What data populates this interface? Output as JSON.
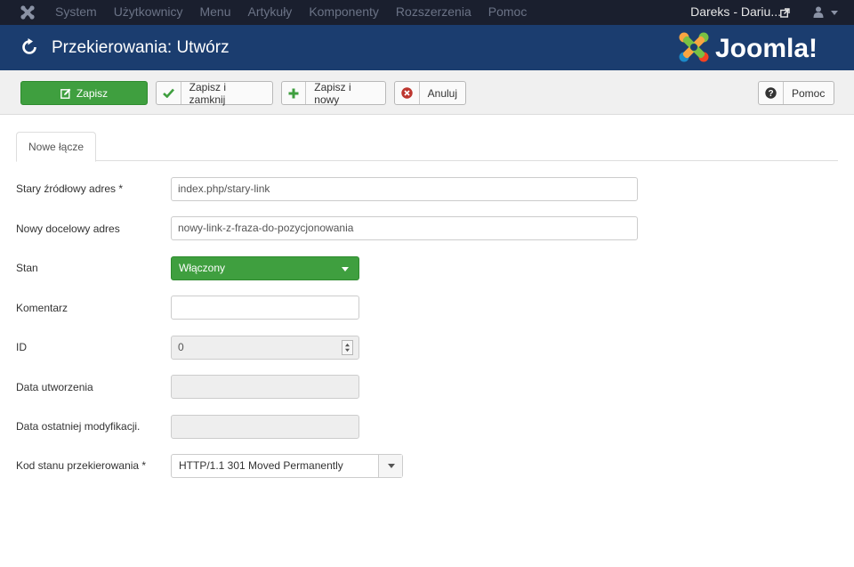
{
  "topbar": {
    "menu": [
      "System",
      "Użytkownicy",
      "Menu",
      "Artykuły",
      "Komponenty",
      "Rozszerzenia",
      "Pomoc"
    ],
    "user_name": "Dareks - Dariu..."
  },
  "header": {
    "title": "Przekierowania: Utwórz",
    "brand": "Joomla!"
  },
  "toolbar": {
    "save": "Zapisz",
    "save_close": "Zapisz i zamknij",
    "save_new": "Zapisz i nowy",
    "cancel": "Anuluj",
    "help": "Pomoc"
  },
  "tabs": [
    "Nowe łącze"
  ],
  "form": {
    "old_url": {
      "label": "Stary źródłowy adres *",
      "value": "index.php/stary-link"
    },
    "new_url": {
      "label": "Nowy docelowy adres",
      "value": "nowy-link-z-fraza-do-pozycjonowania"
    },
    "status": {
      "label": "Stan",
      "value": "Włączony"
    },
    "comment": {
      "label": "Komentarz",
      "value": ""
    },
    "id": {
      "label": "ID",
      "value": "0"
    },
    "created": {
      "label": "Data utworzenia",
      "value": ""
    },
    "modified": {
      "label": "Data ostatniej modyfikacji.",
      "value": ""
    },
    "http_code": {
      "label": "Kod stanu przekierowania *",
      "value": "HTTP/1.1 301 Moved Permanently"
    }
  },
  "colors": {
    "topbar": "#1a1f2e",
    "header": "#1b3d6f",
    "success": "#3f9f3f",
    "danger": "#bd362f"
  }
}
